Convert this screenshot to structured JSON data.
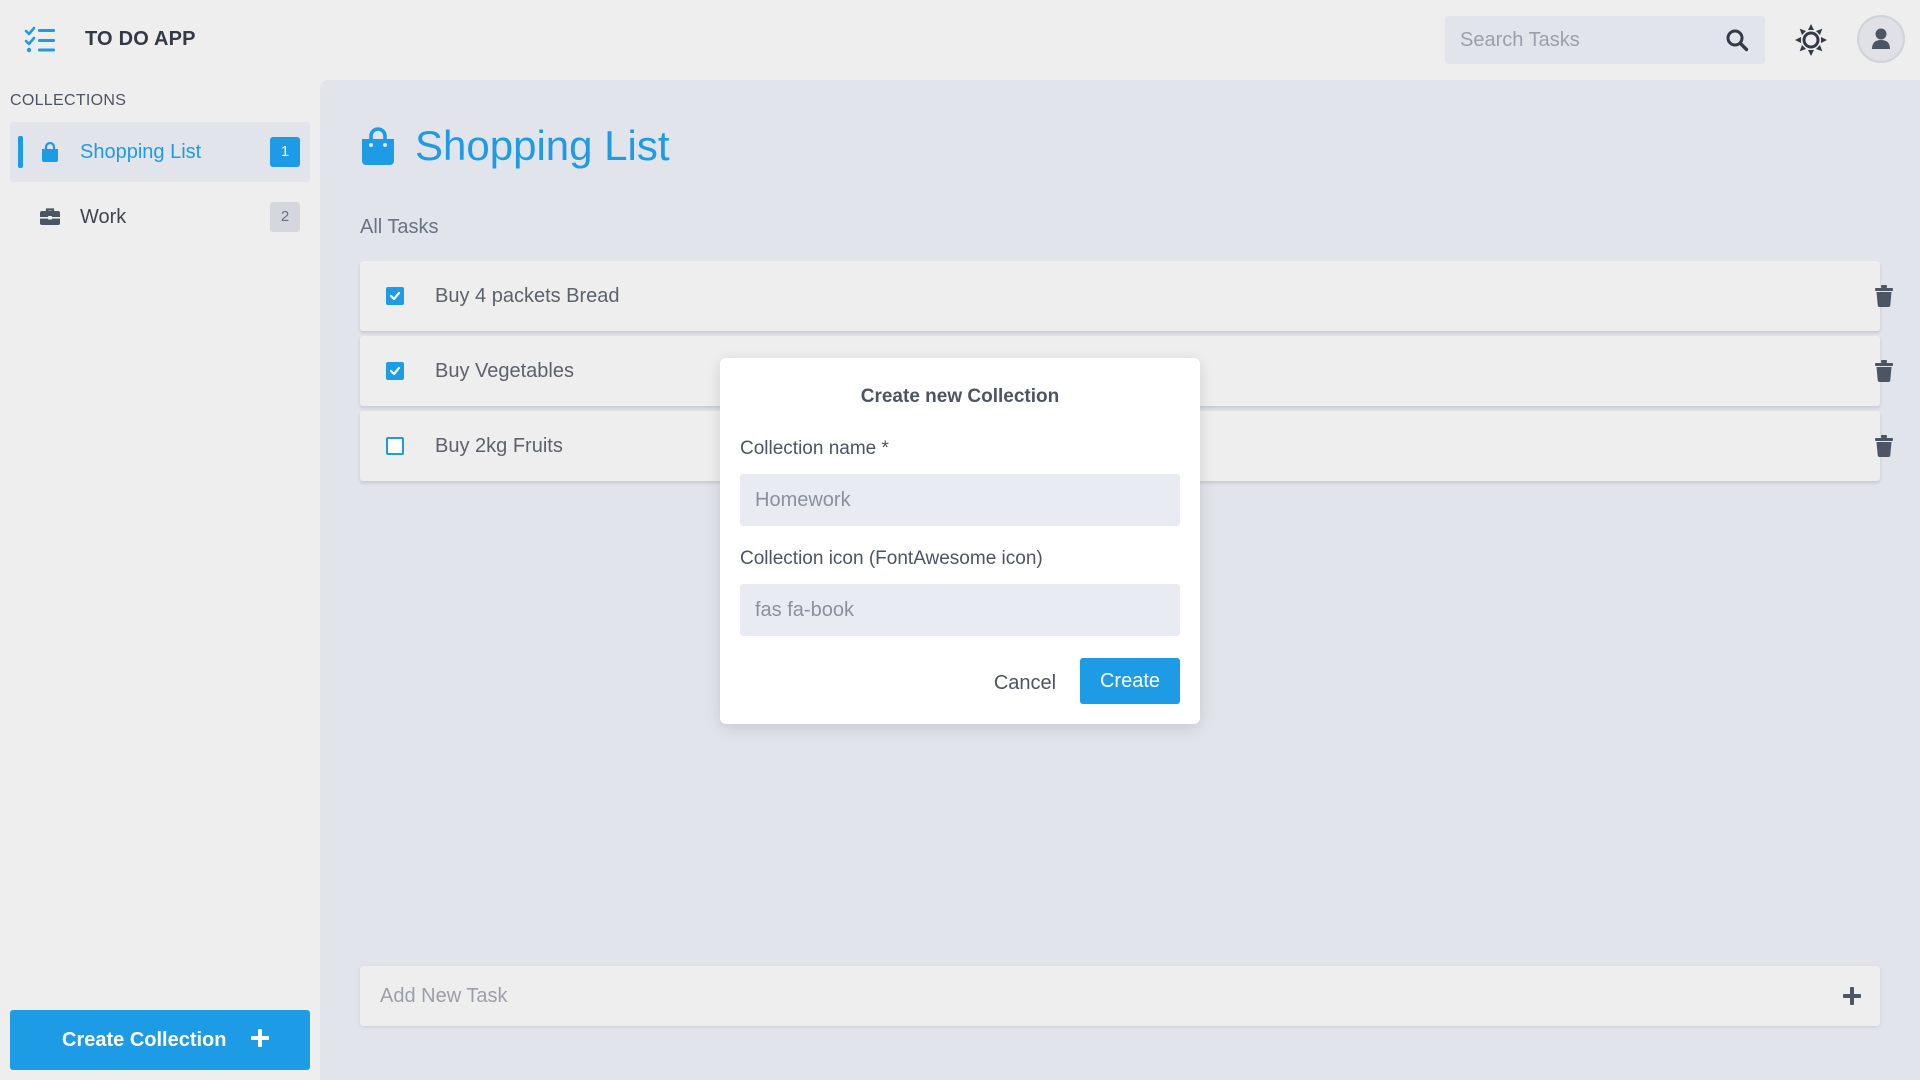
{
  "app": {
    "title": "TO DO APP",
    "logo_icon": "list-check-icon",
    "accent_color": "#1e9be5"
  },
  "header": {
    "search_placeholder": "Search Tasks",
    "search_icon": "search-icon",
    "theme_icon": "sun-icon",
    "avatar_icon": "user-icon"
  },
  "sidebar": {
    "heading": "COLLECTIONS",
    "items": [
      {
        "label": "Shopping List",
        "count": "1",
        "icon": "shopping-bag-icon",
        "active": true
      },
      {
        "label": "Work",
        "count": "2",
        "icon": "briefcase-icon",
        "active": false
      }
    ],
    "create_button": {
      "label": "Create Collection",
      "icon": "plus-icon"
    }
  },
  "main": {
    "collection_title": "Shopping List",
    "collection_icon": "shopping-bag-icon",
    "section_label": "All Tasks",
    "tasks": [
      {
        "label": "Buy 4 packets Bread",
        "done": true
      },
      {
        "label": "Buy Vegetables",
        "done": true
      },
      {
        "label": "Buy 2kg Fruits",
        "done": false
      }
    ],
    "add_task_placeholder": "Add New Task"
  },
  "modal": {
    "title": "Create new Collection",
    "name_label": "Collection name *",
    "name_placeholder": "Homework",
    "icon_label": "Collection icon (FontAwesome icon)",
    "icon_placeholder": "fas fa-book",
    "cancel_label": "Cancel",
    "create_label": "Create"
  }
}
